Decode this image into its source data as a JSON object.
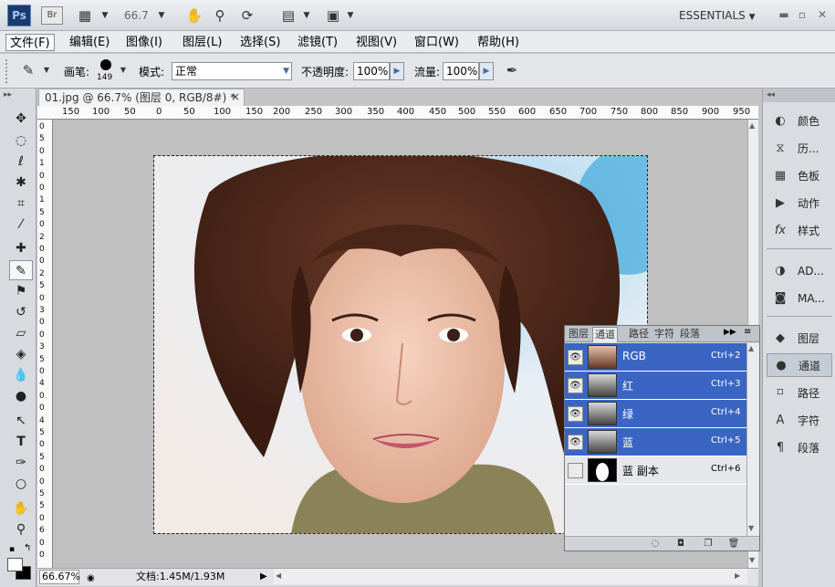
{
  "app": {
    "logo": "Ps",
    "bridge": "Br",
    "zoom": "66.7",
    "workspace": "ESSENTIALS"
  },
  "menu": [
    "文件(F)",
    "编辑(E)",
    "图像(I)",
    "图层(L)",
    "选择(S)",
    "滤镜(T)",
    "视图(V)",
    "窗口(W)",
    "帮助(H)"
  ],
  "options": {
    "brush_label": "画笔:",
    "brush_size": "149",
    "mode_label": "模式:",
    "mode_value": "正常",
    "opacity_label": "不透明度:",
    "opacity_value": "100%",
    "flow_label": "流量:",
    "flow_value": "100%"
  },
  "document": {
    "tab_title": "01.jpg @ 66.7% (图层 0, RGB/8#) *",
    "close": "×"
  },
  "ruler_top": [
    "150",
    "100",
    "50",
    "0",
    "50",
    "100",
    "150",
    "200",
    "250",
    "300",
    "350",
    "400",
    "450",
    "500",
    "550",
    "600",
    "650",
    "700",
    "750",
    "800",
    "850",
    "900",
    "950"
  ],
  "ruler_left": [
    "0",
    "5",
    "0",
    "1",
    "0",
    "0",
    "1",
    "5",
    "0",
    "2",
    "0",
    "0",
    "2",
    "5",
    "0",
    "3",
    "0",
    "0",
    "3",
    "5",
    "0",
    "4",
    "0",
    "0",
    "4",
    "5",
    "0",
    "5",
    "0",
    "0",
    "5",
    "5",
    "0",
    "6",
    "0",
    "0"
  ],
  "status": {
    "zoom": "66.67%",
    "doc": "文档:1.45M/1.93M"
  },
  "dock": {
    "group1": [
      {
        "icon": "color-icon",
        "label": "颜色"
      },
      {
        "icon": "history-icon",
        "label": "历..."
      },
      {
        "icon": "swatches-icon",
        "label": "色板"
      },
      {
        "icon": "actions-icon",
        "label": "动作"
      },
      {
        "icon": "styles-icon",
        "label": "样式"
      }
    ],
    "group2": [
      {
        "icon": "adjustments-icon",
        "label": "AD..."
      },
      {
        "icon": "masks-icon",
        "label": "MA..."
      }
    ],
    "group3": [
      {
        "icon": "layers-icon",
        "label": "图层"
      },
      {
        "icon": "channels-icon",
        "label": "通道"
      },
      {
        "icon": "paths-icon",
        "label": "路径"
      },
      {
        "icon": "character-icon",
        "label": "字符"
      },
      {
        "icon": "paragraph-icon",
        "label": "段落"
      }
    ]
  },
  "panel": {
    "tabs": [
      "图层",
      "通道",
      "路径",
      "字符",
      "段落"
    ],
    "channels": [
      {
        "name": "RGB",
        "shortcut": "Ctrl+2",
        "selected": true,
        "visible": true
      },
      {
        "name": "红",
        "shortcut": "Ctrl+3",
        "selected": true,
        "visible": true
      },
      {
        "name": "绿",
        "shortcut": "Ctrl+4",
        "selected": true,
        "visible": true
      },
      {
        "name": "蓝",
        "shortcut": "Ctrl+5",
        "selected": true,
        "visible": true
      },
      {
        "name": "蓝 副本",
        "shortcut": "Ctrl+6",
        "selected": false,
        "visible": false
      }
    ]
  },
  "colors": {
    "selection": "#3a65c3",
    "panel_bg": "#d9dce0",
    "canvas_bg": "#c0c0c0"
  }
}
